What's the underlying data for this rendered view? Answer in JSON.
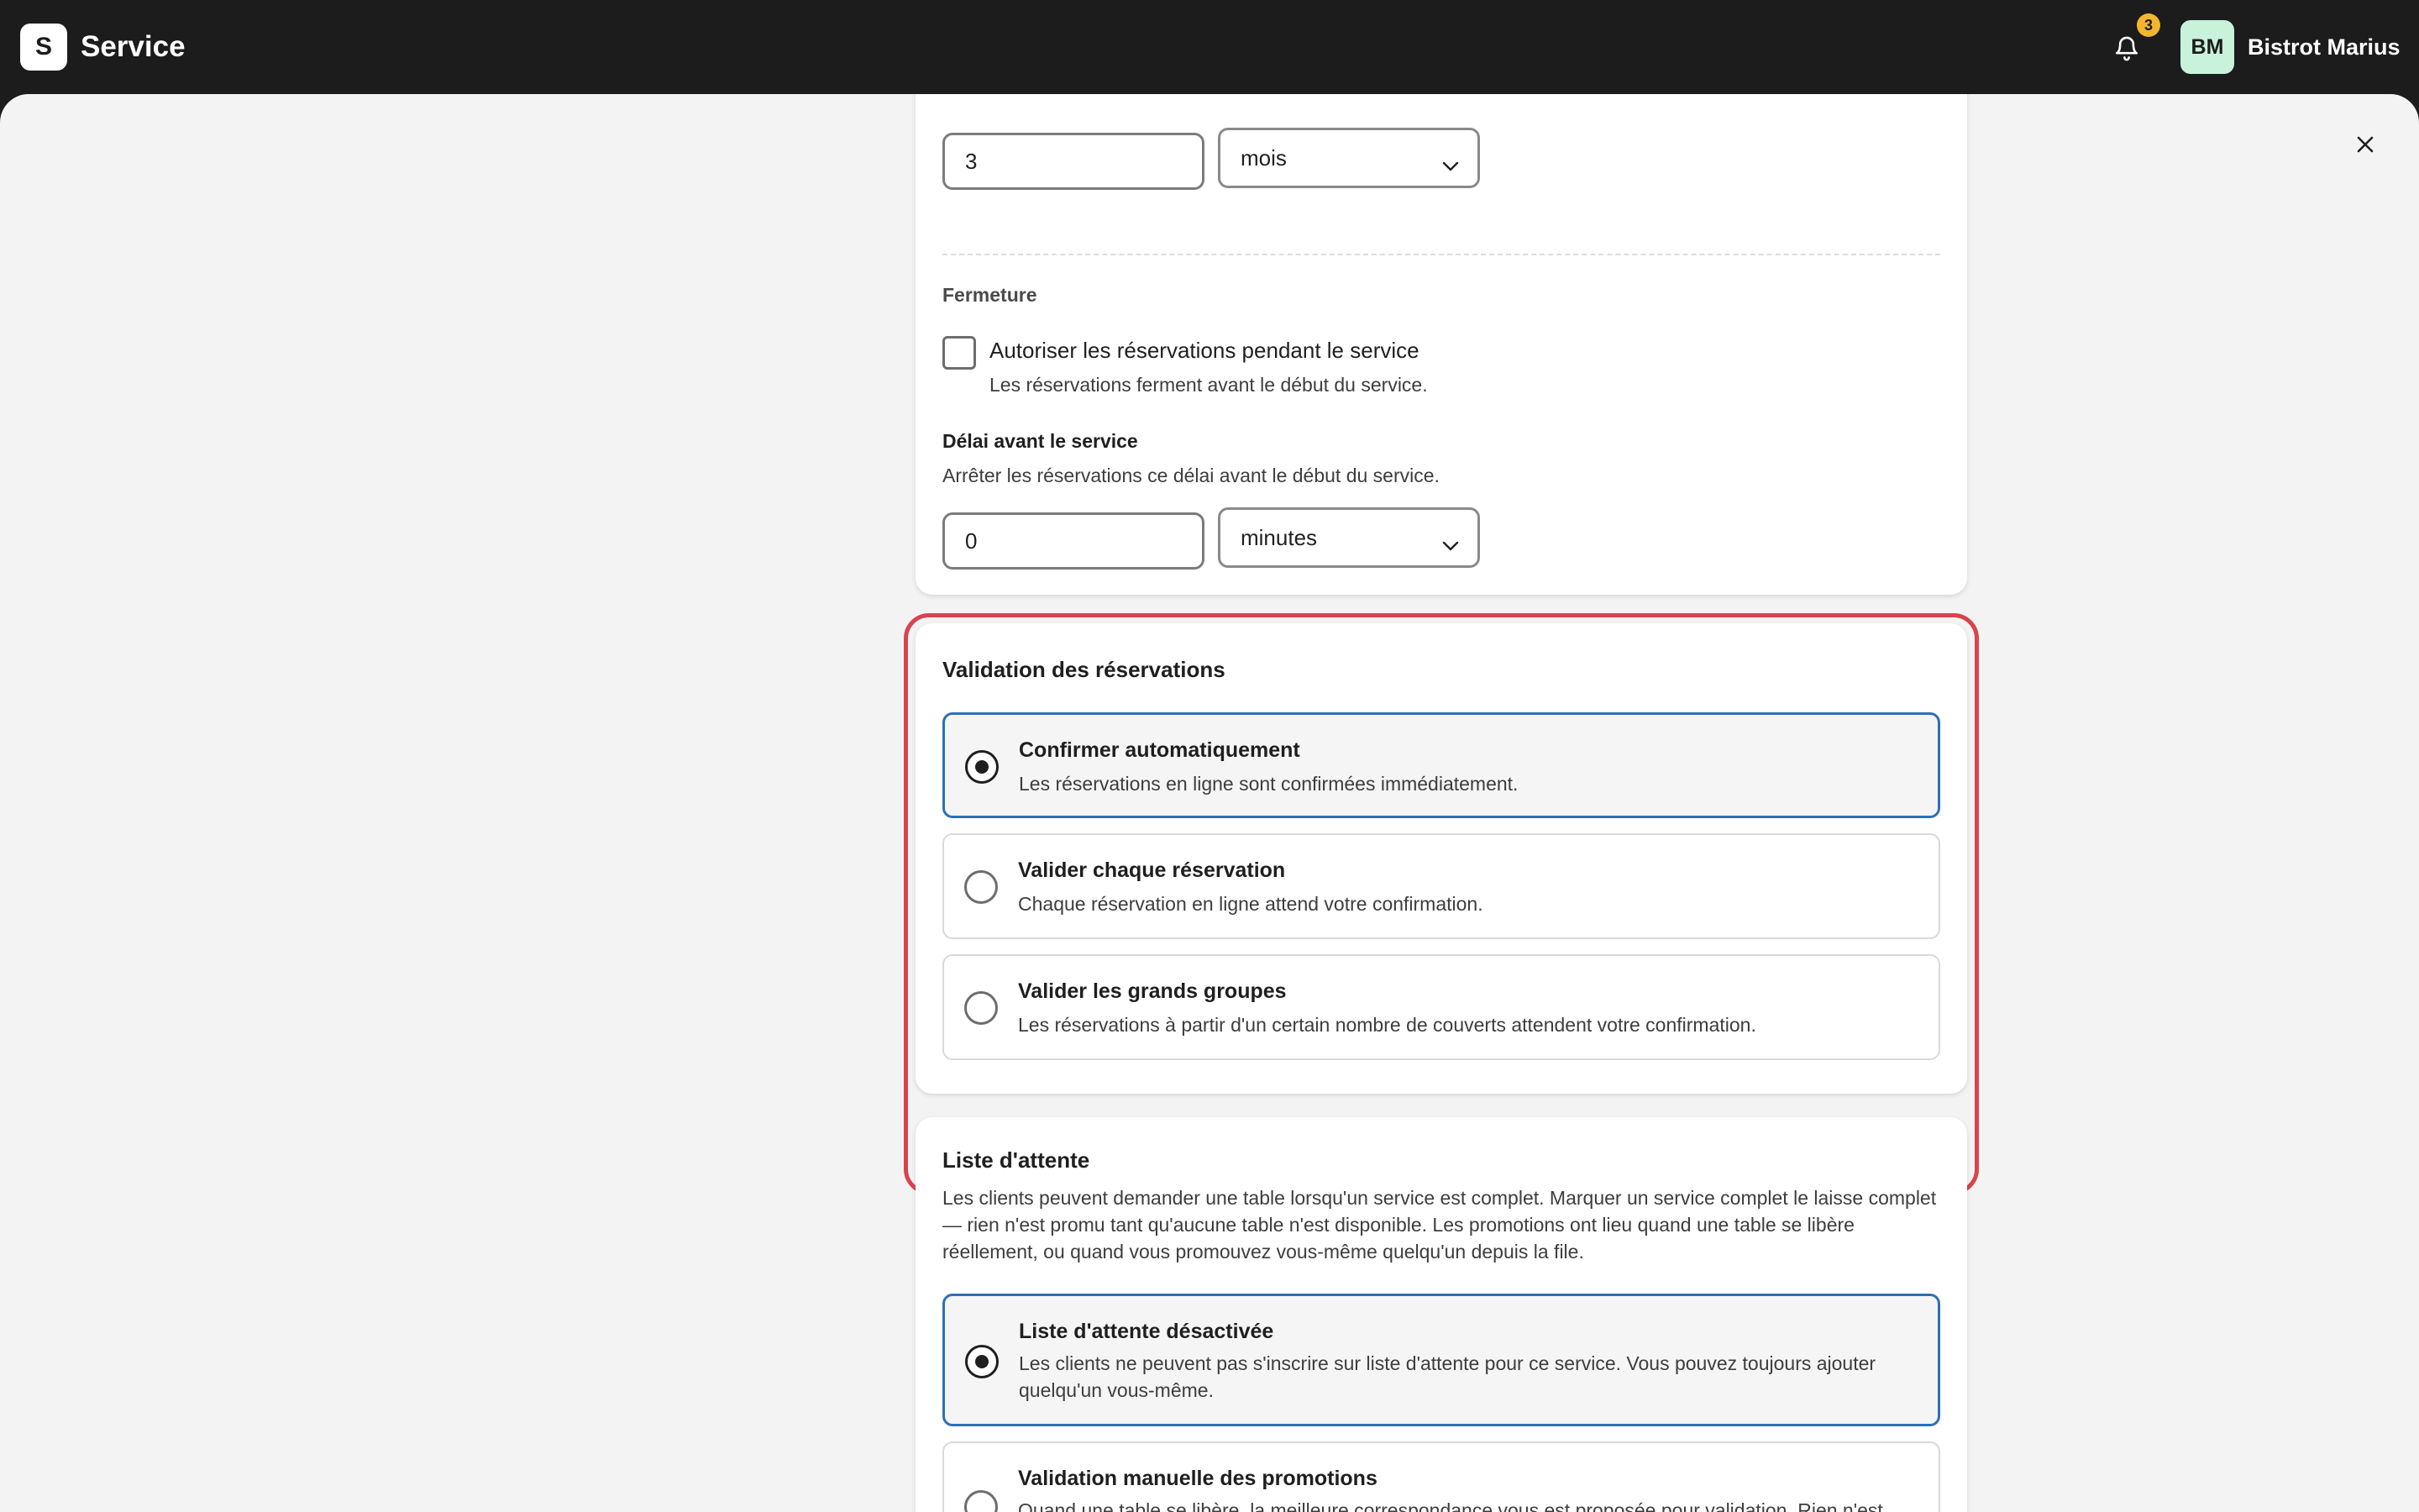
{
  "topbar": {
    "logo_letter": "S",
    "app_title": "Service",
    "notifications_count": "3",
    "avatar_initials": "BM",
    "account_name": "Bistrot Marius"
  },
  "advance": {
    "value": "3",
    "unit": "mois"
  },
  "closing": {
    "heading": "Fermeture",
    "allow_during_service_label": "Autoriser les réservations pendant le service",
    "allow_during_service_checked": false,
    "allow_during_service_help": "Les réservations ferment avant le début du service.",
    "delay_heading": "Délai avant le service",
    "delay_help": "Arrêter les réservations ce délai avant le début du service.",
    "delay_value": "0",
    "delay_unit": "minutes"
  },
  "validation": {
    "title": "Validation des réservations",
    "options": [
      {
        "title": "Confirmer automatiquement",
        "description": "Les réservations en ligne sont confirmées immédiatement.",
        "selected": true
      },
      {
        "title": "Valider chaque réservation",
        "description": "Chaque réservation en ligne attend votre confirmation.",
        "selected": false
      },
      {
        "title": "Valider les grands groupes",
        "description": "Les réservations à partir d'un certain nombre de couverts attendent votre confirmation.",
        "selected": false
      }
    ]
  },
  "waitlist": {
    "title": "Liste d'attente",
    "description": "Les clients peuvent demander une table lorsqu'un service est complet. Marquer un service complet le laisse complet — rien n'est promu tant qu'aucune table n'est disponible. Les promotions ont lieu quand une table se libère réellement, ou quand vous promouvez vous-même quelqu'un depuis la file.",
    "options": [
      {
        "title": "Liste d'attente désactivée",
        "description": "Les clients ne peuvent pas s'inscrire sur liste d'attente pour ce service. Vous pouvez toujours ajouter quelqu'un vous-même.",
        "selected": true
      },
      {
        "title": "Validation manuelle des promotions",
        "description": "Quand une table se libère, la meilleure correspondance vous est proposée pour validation. Rien n'est",
        "selected": false
      }
    ]
  },
  "colors": {
    "topbar": "#1c1c1c",
    "badge": "#f2b52e",
    "avatar": "#c8f3da",
    "selected_border": "#2d6fb7",
    "highlight": "#d8434f"
  }
}
